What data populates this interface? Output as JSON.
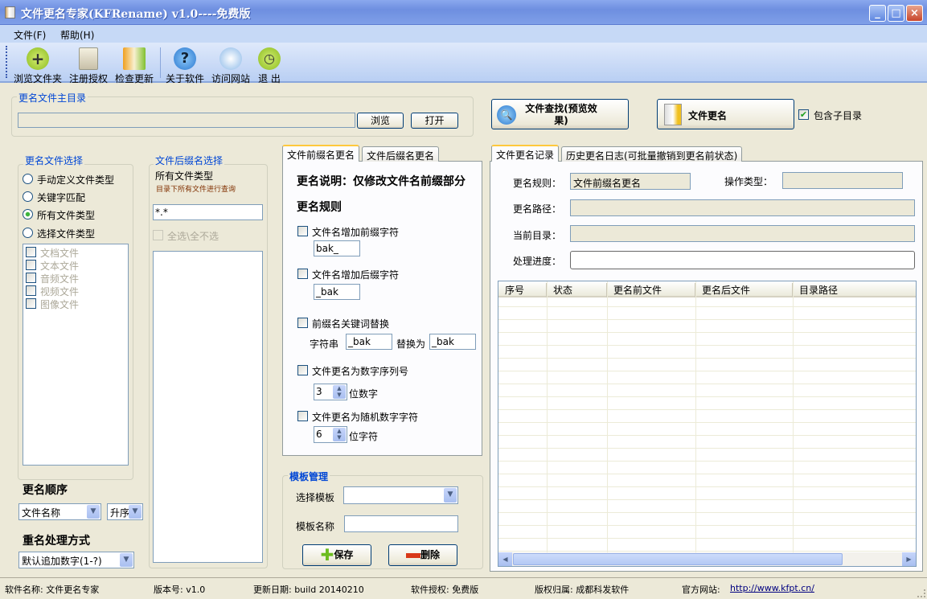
{
  "window": {
    "title": "文件更名专家(KFRename) v1.0----免费版",
    "minimize": "_",
    "maximize": "□",
    "close": "×"
  },
  "menu": [
    "文件(F)",
    "帮助(H)"
  ],
  "toolbar": [
    {
      "label": "浏览文件夹",
      "icon": "add-icon"
    },
    {
      "label": "注册授权",
      "icon": "key-document-icon"
    },
    {
      "label": "检查更新",
      "icon": "update-icon"
    },
    {
      "label": "关于软件",
      "icon": "help-icon"
    },
    {
      "label": "访问网站",
      "icon": "globe-icon"
    },
    {
      "label": "退 出",
      "icon": "exit-clock-icon"
    }
  ],
  "main_dir": {
    "title": "更名文件主目录",
    "value": "",
    "browse": "浏览",
    "open": "打开"
  },
  "file_select": {
    "title": "更名文件选择",
    "radios": [
      "手动定义文件类型",
      "关键字匹配",
      "所有文件类型",
      "选择文件类型"
    ],
    "selected": 2,
    "types": [
      "文档文件",
      "文本文件",
      "音频文件",
      "视频文件",
      "图像文件"
    ]
  },
  "suffix_select": {
    "title": "文件后缀名选择",
    "heading": "所有文件类型",
    "hint": "目录下所有文件进行查询",
    "pattern": "*.*",
    "select_all": "全选\\全不选"
  },
  "order": {
    "title": "更名顺序",
    "field": "文件名称",
    "direction": "升序"
  },
  "dup": {
    "title": "重名处理方式",
    "value": "默认追加数字(1-?)"
  },
  "tabs": {
    "prefix": "文件前缀名更名",
    "suffix": "文件后缀名更名"
  },
  "prefix_tab": {
    "desc": "更名说明：仅修改文件名前缀部分",
    "rules_title": "更名规则",
    "add_prefix": "文件名增加前缀字符",
    "prefix_value": "bak_",
    "add_suffix": "文件名增加后缀字符",
    "suffix_value": "_bak",
    "replace": "前缀名关键词替换",
    "str_label": "字符串",
    "str_value": "_bak",
    "replace_with": "替换为",
    "replace_value": "_bak",
    "seq": "文件更名为数字序列号",
    "seq_digits": "3",
    "seq_unit": "位数字",
    "rand": "文件更名为随机数字字符",
    "rand_digits": "6",
    "rand_unit": "位字符"
  },
  "template": {
    "title": "模板管理",
    "select_label": "选择模板",
    "select_value": "",
    "name_label": "模板名称",
    "name_value": "",
    "save": "保存",
    "delete": "删除"
  },
  "actions": {
    "search": "文件查找(预览效果)",
    "rename": "文件更名",
    "include_sub": "包含子目录"
  },
  "right_tabs": {
    "record": "文件更名记录",
    "history": "历史更名日志(可批量撤销到更名前状态)"
  },
  "record": {
    "rule_label": "更名规则：",
    "rule_value": "文件前缀名更名",
    "op_label": "操作类型：",
    "op_value": "",
    "path_label": "更名路径：",
    "path_value": "",
    "cur_label": "当前目录：",
    "cur_value": "",
    "progress_label": "处理进度：",
    "progress": 0
  },
  "table": {
    "columns": [
      "序号",
      "状态",
      "更名前文件",
      "更名后文件",
      "目录路径"
    ],
    "rows": []
  },
  "status": {
    "name": "软件名称: 文件更名专家",
    "version": "版本号: v1.0",
    "date": "更新日期: build 20140210",
    "license": "软件授权: 免费版",
    "owner": "版权归属: 成都科发软件",
    "site_label": "官方网站:",
    "site": "http://www.kfpt.cn/"
  }
}
